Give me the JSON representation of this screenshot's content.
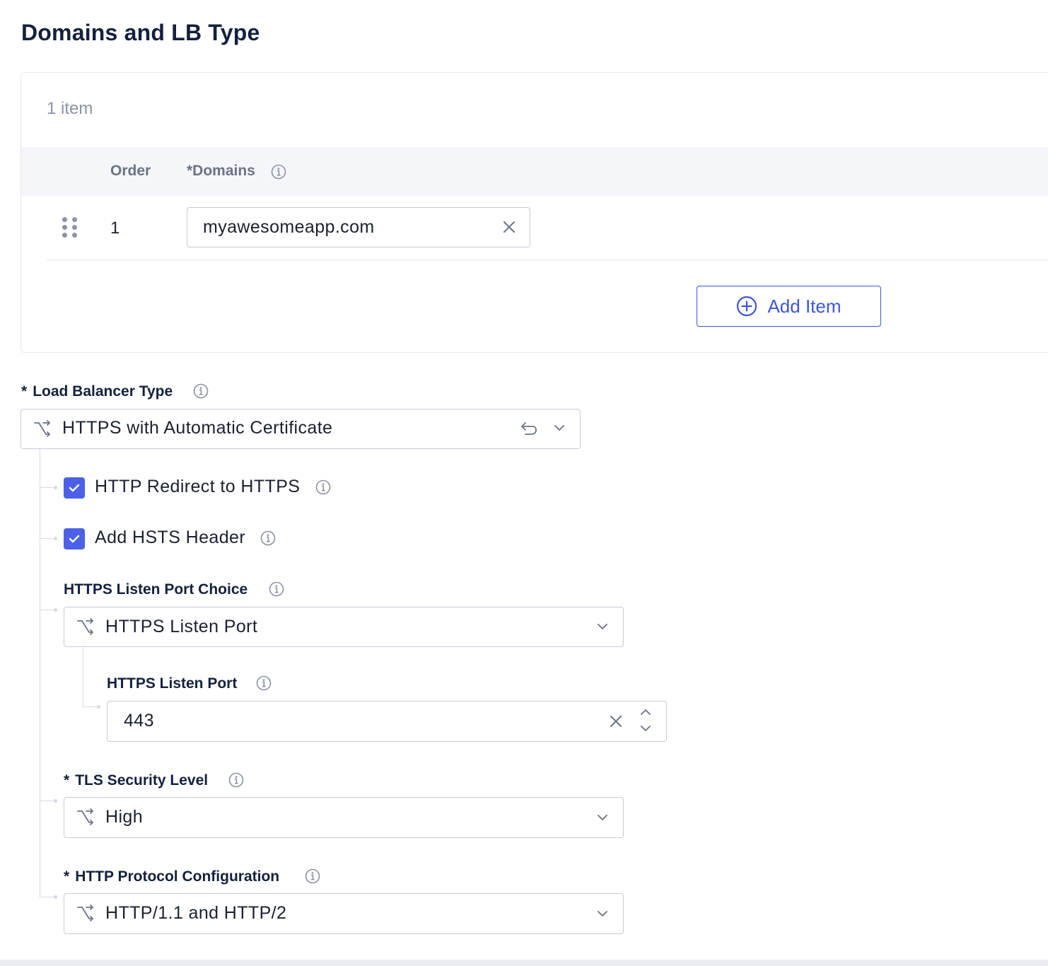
{
  "page": {
    "title": "Domains and LB Type"
  },
  "domains": {
    "item_count": "1 item",
    "columns": {
      "order": "Order",
      "domains": "*Domains"
    },
    "rows": [
      {
        "order": "1",
        "value": "myawesomeapp.com"
      }
    ],
    "add_label": "Add Item"
  },
  "lb_type": {
    "required_mark": "*",
    "label": "Load Balancer Type",
    "value": "HTTPS with Automatic Certificate"
  },
  "http_redirect": {
    "label": "HTTP Redirect to HTTPS",
    "checked": true
  },
  "hsts": {
    "label": "Add HSTS Header",
    "checked": true
  },
  "port_choice": {
    "label": "HTTPS Listen Port Choice",
    "value": "HTTPS Listen Port"
  },
  "listen_port": {
    "label": "HTTPS Listen Port",
    "value": "443"
  },
  "tls": {
    "required_mark": "*",
    "label": "TLS Security Level",
    "value": "High"
  },
  "http_protocol": {
    "required_mark": "*",
    "label": "HTTP Protocol Configuration",
    "value": "HTTP/1.1 and HTTP/2"
  },
  "icons": {
    "info": "info-icon",
    "clear": "close-icon",
    "chevron": "chevron-down-icon",
    "choice": "choice-split-icon",
    "reset": "return-icon",
    "drag": "drag-handle-icon",
    "add": "plus-circle-icon"
  },
  "colors": {
    "accent": "#3d56d9",
    "checkbox": "#4c61e8",
    "heading": "#14213d",
    "muted": "#8a92a6"
  }
}
